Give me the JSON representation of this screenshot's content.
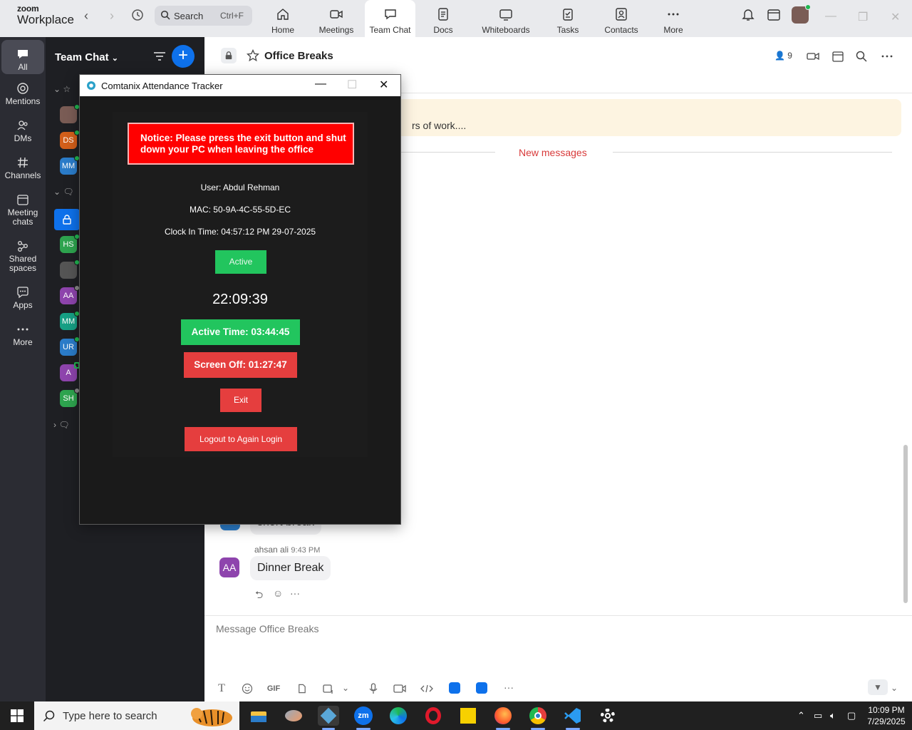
{
  "app": {
    "logo_line1": "zoom",
    "logo_line2": "Workplace",
    "search_label": "Search",
    "search_shortcut": "Ctrl+F",
    "tabs": [
      {
        "label": "Home",
        "icon": "home-icon"
      },
      {
        "label": "Meetings",
        "icon": "video-camera-icon"
      },
      {
        "label": "Team Chat",
        "icon": "chat-bubble-icon",
        "active": true
      },
      {
        "label": "Docs",
        "icon": "document-icon"
      },
      {
        "label": "Whiteboards",
        "icon": "whiteboard-icon"
      },
      {
        "label": "Tasks",
        "icon": "tasks-icon"
      },
      {
        "label": "Contacts",
        "icon": "contacts-icon"
      },
      {
        "label": "More",
        "icon": "more-dots-icon"
      }
    ]
  },
  "rail": {
    "items": [
      {
        "label": "All",
        "icon": "chat-bubble-icon",
        "active": true
      },
      {
        "label": "Mentions",
        "icon": "at-sign-icon"
      },
      {
        "label": "DMs",
        "icon": "people-icon"
      },
      {
        "label": "Channels",
        "icon": "hash-icon"
      },
      {
        "label": "Meeting chats",
        "icon": "calendar-icon"
      },
      {
        "label": "Shared spaces",
        "icon": "share-nodes-icon"
      },
      {
        "label": "Apps",
        "icon": "apps-icon"
      },
      {
        "label": "More",
        "icon": "ellipsis-icon"
      }
    ]
  },
  "chatlist": {
    "title": "Team Chat",
    "plus": "+",
    "avatars": [
      {
        "initials": "",
        "color": "#7a5c55",
        "status": "online"
      },
      {
        "initials": "DS",
        "color": "#d35f1a",
        "status": "online"
      },
      {
        "initials": "MM",
        "color": "#2b7cc9",
        "status": "online"
      },
      {
        "initials": "",
        "color": "#0e71eb",
        "status": "none",
        "icon": "lock-icon"
      },
      {
        "initials": "HS",
        "color": "#2ea44f",
        "status": "online"
      },
      {
        "initials": "",
        "color": "#555555",
        "status": "online"
      },
      {
        "initials": "AA",
        "color": "#8e44ad",
        "status": "away"
      },
      {
        "initials": "MM",
        "color": "#16a085",
        "status": "online"
      },
      {
        "initials": "UR",
        "color": "#2b7cc9",
        "status": "online"
      },
      {
        "initials": "A",
        "color": "#8e44ad",
        "status": "mobile"
      },
      {
        "initials": "SH",
        "color": "#2ea44f",
        "status": "away"
      }
    ]
  },
  "channel": {
    "title": "Office Breaks",
    "members": "9",
    "banner_text": "rs of work....",
    "new_messages": "New messages",
    "partial_message": "short break",
    "last_message": {
      "author": "ahsan ali",
      "time": "9:43 PM",
      "avatar": "AA",
      "text": "Dinner Break"
    },
    "composer_placeholder": "Message Office Breaks",
    "composer_tools": [
      "T",
      "emoji-icon",
      "GIF",
      "file-icon",
      "screenshot-icon",
      "mic-icon",
      "video-clip-icon",
      "code-icon",
      "app1-icon",
      "app2-icon",
      "more-icon"
    ]
  },
  "dialog": {
    "title": "Comtanix Attendance Tracker",
    "notice_line1": "Notice: Please press the exit button and shut",
    "notice_line2": "down your PC when leaving the office",
    "user": "User: Abdul Rehman",
    "mac": "MAC: 50-9A-4C-55-5D-EC",
    "clock_in": "Clock In Time: 04:57:12 PM 29-07-2025",
    "status": "Active",
    "clock": "22:09:39",
    "active_time": "Active Time: 03:44:45",
    "screen_off": "Screen Off: 01:27:47",
    "exit": "Exit",
    "logout": "Logout to Again Login"
  },
  "taskbar": {
    "search_placeholder": "Type here to search",
    "time": "10:09 PM",
    "date": "7/29/2025",
    "apps": [
      "file-explorer-icon",
      "app-icon",
      "zoom-workplace-icon",
      "zoom-icon",
      "edge-icon",
      "opera-icon",
      "sticky-notes-icon",
      "firefox-icon",
      "chrome-icon",
      "vscode-icon",
      "settings-icon"
    ]
  }
}
